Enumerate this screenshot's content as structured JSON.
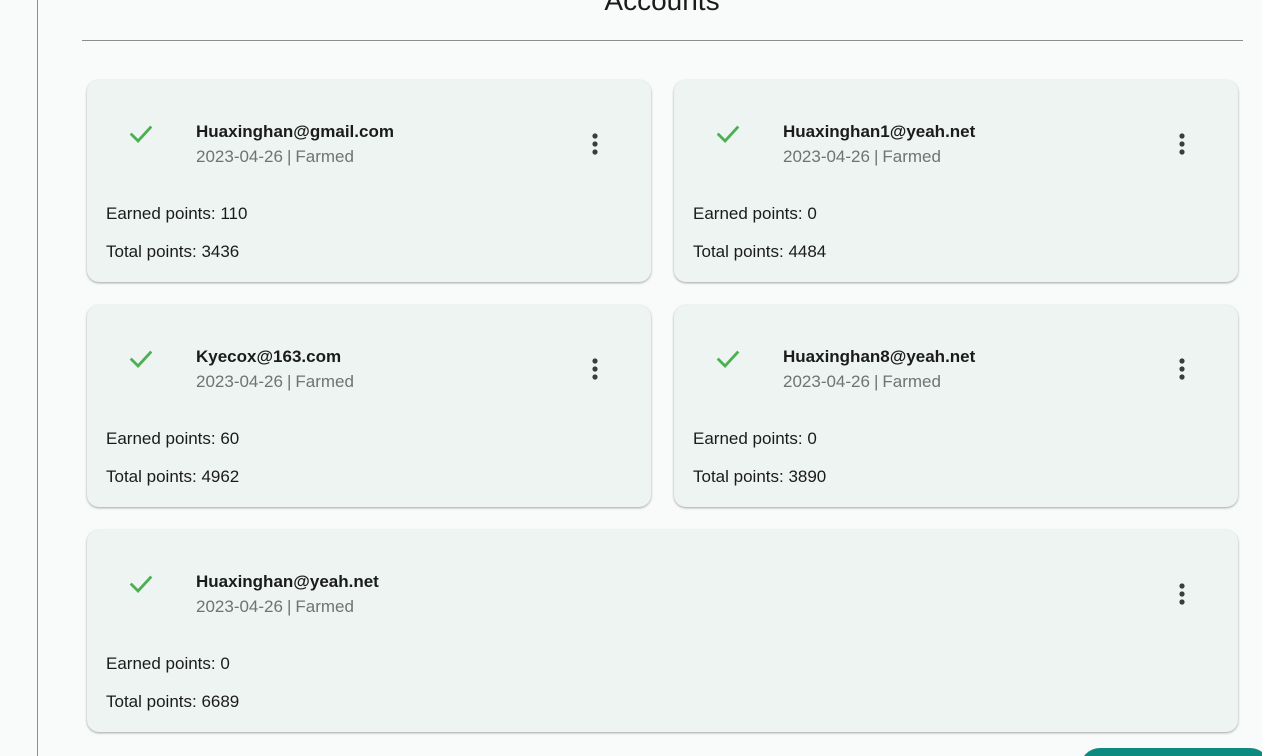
{
  "page": {
    "title": "Accounts"
  },
  "accounts": [
    {
      "email": "Huaxinghan@gmail.com",
      "date": "2023-04-26",
      "separator": "|",
      "status": "Farmed",
      "earned": "Earned points: 110",
      "total": "Total points: 3436"
    },
    {
      "email": "Huaxinghan1@yeah.net",
      "date": "2023-04-26",
      "separator": "|",
      "status": "Farmed",
      "earned": "Earned points: 0",
      "total": "Total points: 4484"
    },
    {
      "email": "Kyecox@163.com",
      "date": "2023-04-26",
      "separator": "|",
      "status": "Farmed",
      "earned": "Earned points: 60",
      "total": "Total points: 4962"
    },
    {
      "email": "Huaxinghan8@yeah.net",
      "date": "2023-04-26",
      "separator": "|",
      "status": "Farmed",
      "earned": "Earned points: 0",
      "total": "Total points: 3890"
    },
    {
      "email": "Huaxinghan@yeah.net",
      "date": "2023-04-26",
      "separator": "|",
      "status": "Farmed",
      "earned": "Earned points: 0",
      "total": "Total points: 6689"
    }
  ],
  "icons": {
    "status": "check-icon",
    "menu": "more-vertical-icon"
  },
  "colors": {
    "success": "#4caf50",
    "card_background": "#edf4f1",
    "accent": "#0d8a80"
  }
}
